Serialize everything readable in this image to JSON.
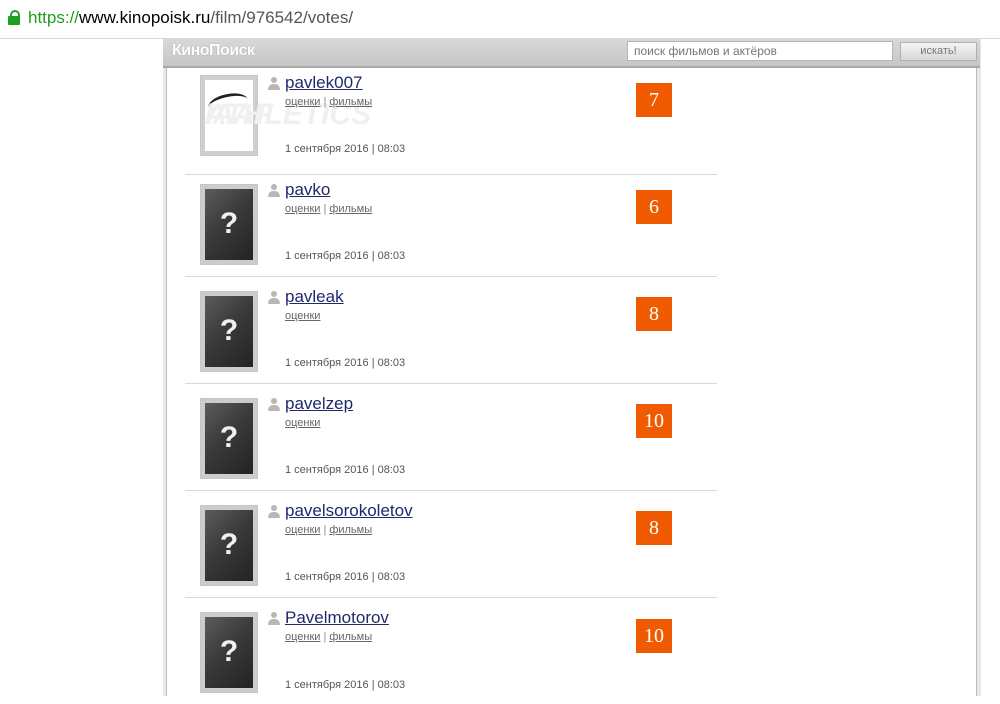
{
  "browser": {
    "url_scheme": "https://",
    "url_host": "www.kinopoisk.ru",
    "url_path": "/film/976542/votes/"
  },
  "site": {
    "logo": "КиноПоиск",
    "search_placeholder": "поиск фильмов и актёров",
    "search_button": "искать!"
  },
  "votes": [
    {
      "username": "pavlek007",
      "link_ratings": "оценки",
      "link_films": "фильмы",
      "separator": "|",
      "date": "1 сентября 2016 | 08:03",
      "score": "7",
      "avatar": "iaaf-athletics"
    },
    {
      "username": "pavko",
      "link_ratings": "оценки",
      "link_films": "фильмы",
      "separator": "|",
      "date": "1 сентября 2016 | 08:03",
      "score": "6",
      "avatar": "placeholder"
    },
    {
      "username": "pavleak",
      "link_ratings": "оценки",
      "date": "1 сентября 2016 | 08:03",
      "score": "8",
      "avatar": "placeholder"
    },
    {
      "username": "pavelzep",
      "link_ratings": "оценки",
      "date": "1 сентября 2016 | 08:03",
      "score": "10",
      "avatar": "placeholder"
    },
    {
      "username": "pavelsorokoletov",
      "link_ratings": "оценки",
      "link_films": "фильмы",
      "separator": "|",
      "date": "1 сентября 2016 | 08:03",
      "score": "8",
      "avatar": "placeholder"
    },
    {
      "username": "Pavelmotorov",
      "link_ratings": "оценки",
      "link_films": "фильмы",
      "separator": "|",
      "date": "1 сентября 2016 | 08:03",
      "score": "10",
      "avatar": "placeholder"
    }
  ],
  "placeholder_glyph": "?",
  "avatar_logo_text": "IAAF",
  "avatar_logo_sub": "ATHLETICS",
  "colors": {
    "score_bg": "#f05a00",
    "username": "#1f2a6b",
    "secure": "#1f9f1f"
  }
}
